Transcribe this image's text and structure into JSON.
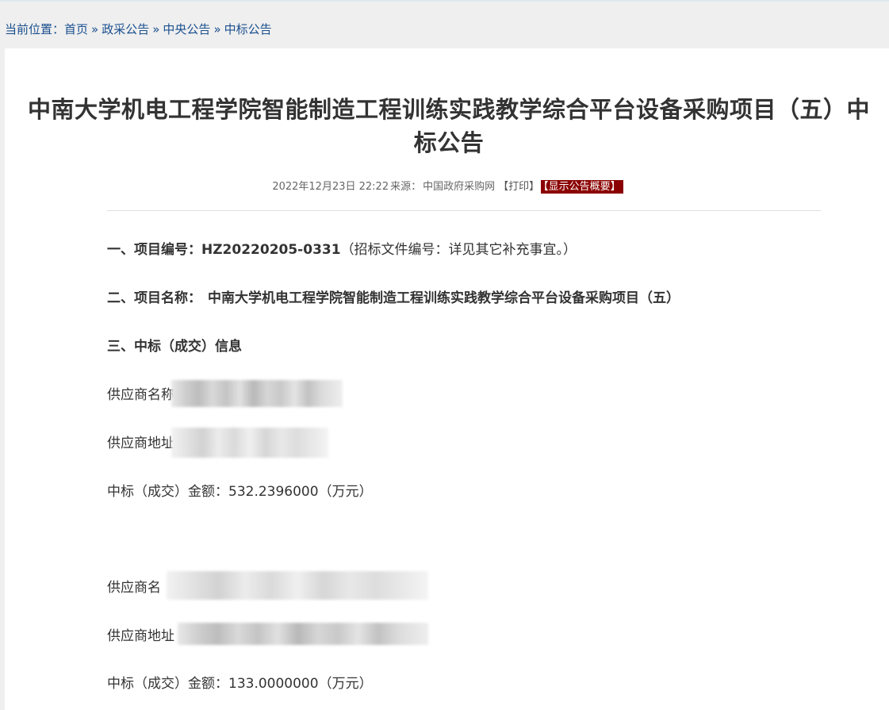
{
  "breadcrumb": {
    "label": "当前位置：",
    "items": [
      "首页",
      "政采公告",
      "中央公告",
      "中标公告"
    ],
    "sep": "»"
  },
  "article": {
    "title": "中南大学机电工程学院智能制造工程训练实践教学综合平台设备采购项目（五）中标公告",
    "datetime": "2022年12月23日 22:22",
    "source_label": "来源：",
    "source": "中国政府采购网",
    "print_label": "【打印】",
    "summary_label": "【显示公告概要】"
  },
  "sections": {
    "s1_label": "一、项目编号：",
    "s1_value": "HZ20220205-0331",
    "s1_note": "（招标文件编号：详见其它补充事宜。）",
    "s2_label": "二、项目名称：",
    "s2_value": "中南大学机电工程学院智能制造工程训练实践教学综合平台设备采购项目（五）",
    "s3_label": "三、中标（成交）信息"
  },
  "suppliers": [
    {
      "name_label": "供应商名称",
      "address_label": "供应商地址",
      "amount_label": "中标（成交）金额：",
      "amount": "532.2396000（万元）"
    },
    {
      "name_label": "供应商名",
      "address_label": "供应商地址",
      "amount_label": "中标（成交）金额：",
      "amount": "133.0000000（万元）"
    }
  ]
}
